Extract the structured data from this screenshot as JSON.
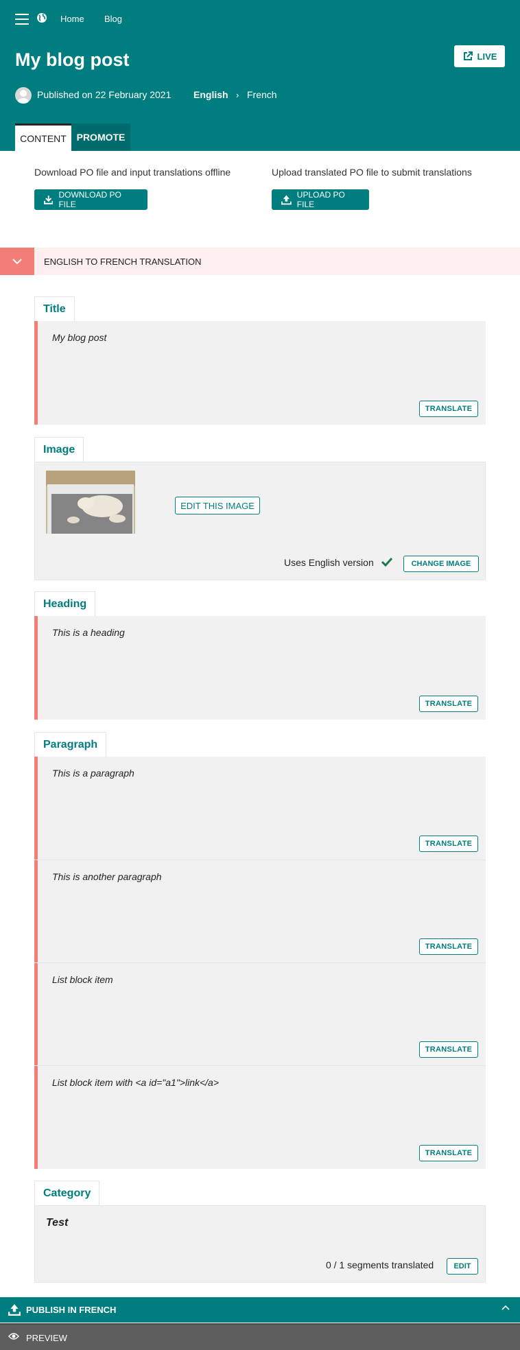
{
  "header": {
    "breadcrumb": [
      "Home",
      "Blog"
    ],
    "title": "My blog post",
    "live_label": "LIVE",
    "published": "Published on 22 February 2021",
    "source_lang": "English",
    "target_lang": "French",
    "tabs": [
      "CONTENT",
      "PROMOTE"
    ]
  },
  "po": {
    "download_text": "Download PO file and input translations offline",
    "download_label": "DOWNLOAD PO FILE",
    "upload_text": "Upload translated PO file to submit translations",
    "upload_label": "UPLOAD PO FILE"
  },
  "translation": {
    "title": "ENGLISH TO FRENCH TRANSLATION"
  },
  "fields": {
    "title": {
      "label": "Title",
      "segments": [
        "My blog post"
      ]
    },
    "image": {
      "label": "Image",
      "edit_label": "EDIT THIS IMAGE",
      "status": "Uses English version",
      "change_label": "CHANGE IMAGE"
    },
    "heading": {
      "label": "Heading",
      "segments": [
        "This is a heading"
      ]
    },
    "paragraph": {
      "label": "Paragraph",
      "segments": [
        "This is a paragraph",
        "This is another paragraph",
        "List block item",
        "List block item with <a id=\"a1\">link</a>"
      ]
    },
    "category": {
      "label": "Category",
      "value": "Test",
      "status": "0 / 1 segments translated",
      "edit_label": "EDIT"
    }
  },
  "translate_label": "TRANSLATE",
  "footer": {
    "publish_label": "PUBLISH IN FRENCH",
    "preview_label": "PREVIEW"
  },
  "colors": {
    "brand": "#007d7e",
    "segment_accent": "#f37e77",
    "translation_bar_bg": "#fcefed"
  }
}
